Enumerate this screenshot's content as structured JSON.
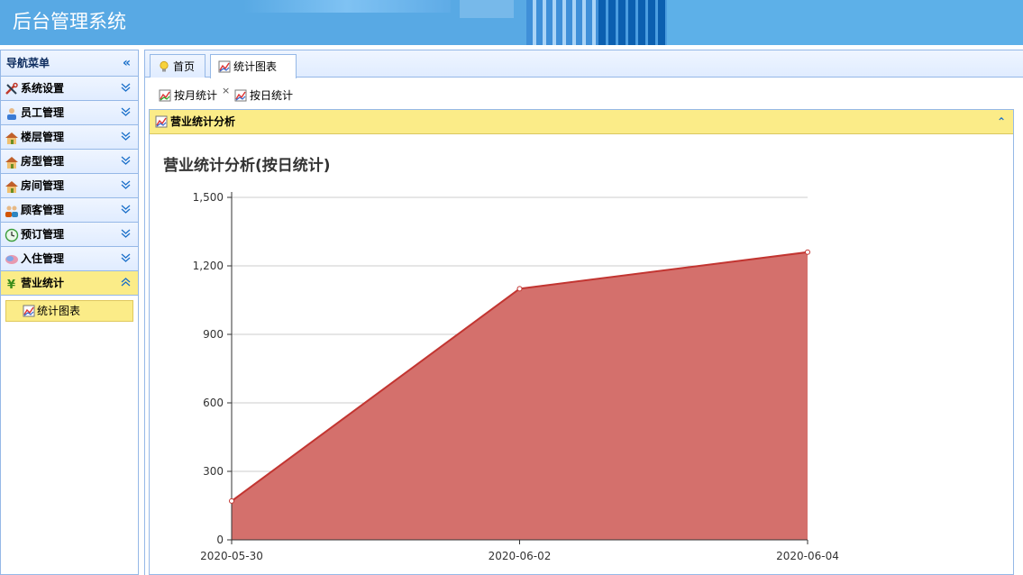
{
  "header": {
    "title": "后台管理系统"
  },
  "sidebar": {
    "title": "导航菜单",
    "groups": [
      {
        "label": "系统设置",
        "icon": "tools-icon"
      },
      {
        "label": "员工管理",
        "icon": "staff-icon"
      },
      {
        "label": "楼层管理",
        "icon": "house-icon"
      },
      {
        "label": "房型管理",
        "icon": "house-icon"
      },
      {
        "label": "房间管理",
        "icon": "house-icon"
      },
      {
        "label": "顾客管理",
        "icon": "customers-icon"
      },
      {
        "label": "预订管理",
        "icon": "clock-icon"
      },
      {
        "label": "入住管理",
        "icon": "checkin-icon"
      },
      {
        "label": "营业统计",
        "icon": "yen-icon"
      }
    ],
    "active_sub": {
      "label": "统计图表",
      "icon": "chart-icon"
    }
  },
  "tabs": [
    {
      "label": "首页",
      "icon": "bulb-icon"
    },
    {
      "label": "统计图表",
      "icon": "chart-icon",
      "close": "×"
    }
  ],
  "toolbar": {
    "monthly": "按月统计",
    "daily": "按日统计"
  },
  "panel": {
    "title": "营业统计分析"
  },
  "colors": {
    "fill": "#d4706c",
    "line": "#c23531",
    "header": "#58a9e4",
    "accent": "#fbec88"
  },
  "chart_data": {
    "type": "area",
    "title": "营业统计分析(按日统计)",
    "x": [
      "2020-05-30",
      "2020-06-02",
      "2020-06-04"
    ],
    "values": [
      170,
      1100,
      1260
    ],
    "yticks": [
      "0",
      "300",
      "600",
      "900",
      "1,200",
      "1,500"
    ],
    "ylim": [
      0,
      1500
    ],
    "grid": true
  }
}
